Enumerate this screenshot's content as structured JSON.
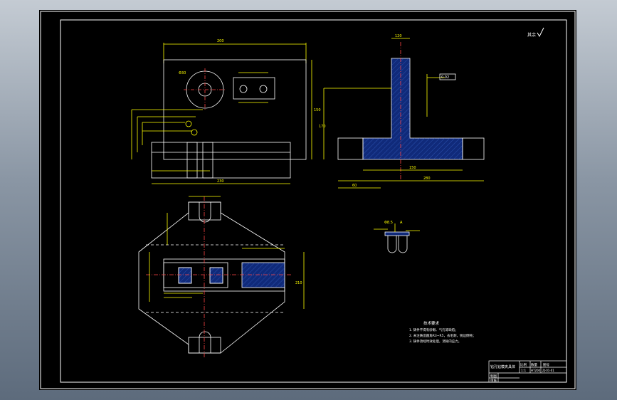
{
  "drawing": {
    "roughness": "其余",
    "notes_title": "技术要求",
    "notes": [
      "1. 铸件不得有砂眼、气孔等缺陷；",
      "2. 未注铸造圆角R3~R5，去毛刺，锐边倒钝；",
      "3. 铸件须经时效处理，消除内应力。"
    ]
  },
  "title_block": {
    "part_name": "钻孔钻模夹具体",
    "col_ratio": "比例",
    "col_qty": "数量",
    "col_drawing_no": "图号",
    "ratio_value": "1:1",
    "qty_value": "HT200",
    "drawing_no_value": "ZJ-01-01",
    "drawn_by": "制图",
    "checked_by": "审核"
  },
  "dimensions": {
    "front_width": "200",
    "front_height": "150",
    "base_width": "230",
    "hole_dia": "Φ30",
    "side_total": "280",
    "side_mid": "150",
    "side_left": "60",
    "side_height": "170",
    "top_width": "120",
    "plan_width": "210",
    "tol_value": "0.02",
    "tol_datum": "A",
    "slot_dia": "Φ8.5"
  }
}
